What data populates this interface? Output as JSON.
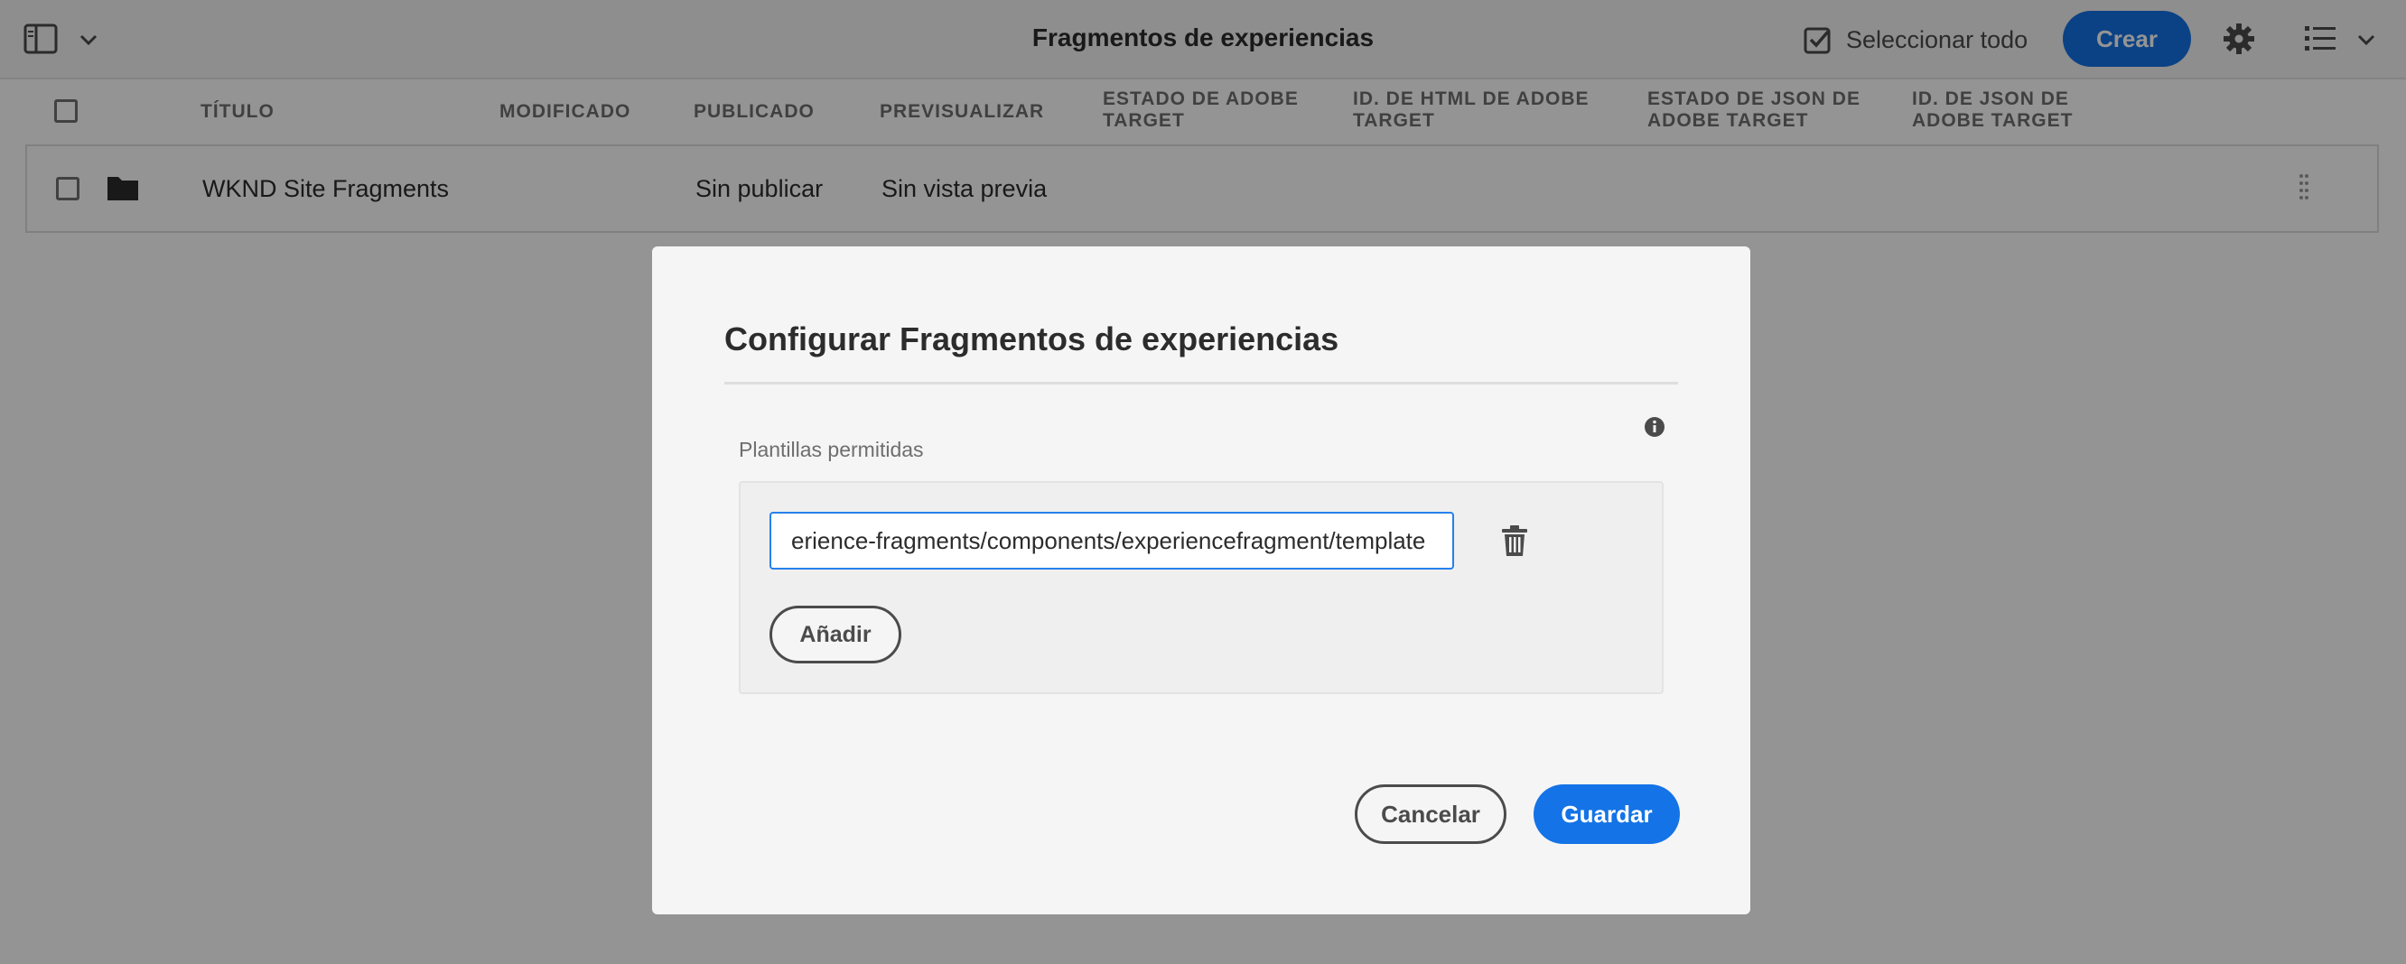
{
  "header": {
    "title": "Fragmentos de experiencias",
    "select_all_label": "Seleccionar todo",
    "create_label": "Crear",
    "icons": [
      "rail-toggle-icon",
      "chevron-down-icon",
      "checkbox-checked-icon",
      "gear-icon",
      "list-view-icon"
    ]
  },
  "table": {
    "columns": [
      "TÍTULO",
      "MODIFICADO",
      "PUBLICADO",
      "PREVISUALIZAR",
      "ESTADO DE ADOBE TARGET",
      "ID. DE HTML DE ADOBE TARGET",
      "ESTADO DE JSON DE ADOBE TARGET",
      "ID. DE JSON DE ADOBE TARGET"
    ],
    "rows": [
      {
        "title": "WKND Site Fragments",
        "modified": "",
        "published": "Sin publicar",
        "preview": "Sin vista previa",
        "icon": "folder-icon"
      }
    ]
  },
  "dialog": {
    "title": "Configurar Fragmentos de experiencias",
    "field_label": "Plantillas permitidas",
    "template_value": "erience-fragments/components/experiencefragment/template",
    "add_label": "Añadir",
    "cancel_label": "Cancelar",
    "save_label": "Guardar",
    "icons": [
      "info-icon",
      "trash-icon"
    ]
  },
  "colors": {
    "accent": "#1473e6",
    "overlay": "rgba(0,0,0,0.42)",
    "dialog_bg": "#f5f5f5"
  }
}
